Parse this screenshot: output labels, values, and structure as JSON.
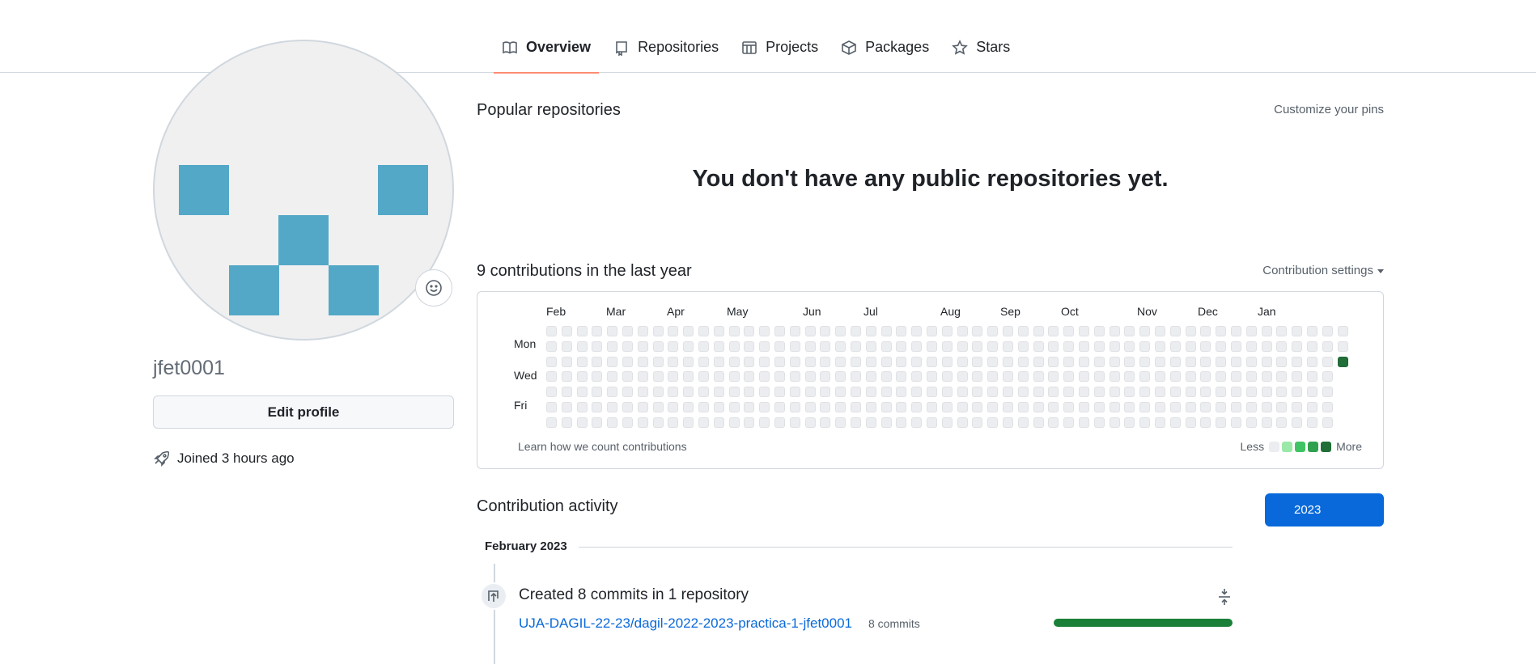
{
  "tabs": [
    {
      "label": "Overview",
      "icon": "book-icon",
      "active": true
    },
    {
      "label": "Repositories",
      "icon": "repo-icon",
      "active": false
    },
    {
      "label": "Projects",
      "icon": "table-icon",
      "active": false
    },
    {
      "label": "Packages",
      "icon": "package-icon",
      "active": false
    },
    {
      "label": "Stars",
      "icon": "star-icon",
      "active": false
    }
  ],
  "profile": {
    "username": "jfet0001",
    "edit_label": "Edit profile",
    "joined": "Joined 3 hours ago",
    "avatar_color": "#54a8c7",
    "status_icon": "smiley-icon"
  },
  "popular": {
    "title": "Popular repositories",
    "customize_label": "Customize your pins",
    "empty_message": "You don't have any public repositories yet."
  },
  "contributions": {
    "title": "9 contributions in the last year",
    "settings_label": "Contribution settings",
    "months": [
      "Feb",
      "Mar",
      "Apr",
      "May",
      "Jun",
      "Jul",
      "Aug",
      "Sep",
      "Oct",
      "Nov",
      "Dec",
      "Jan"
    ],
    "day_labels": [
      "Mon",
      "Wed",
      "Fri"
    ],
    "learn_label": "Learn how we count contributions",
    "legend_less": "Less",
    "legend_more": "More",
    "levels": [
      "#ebedf0",
      "#9be9a8",
      "#40c463",
      "#30a14e",
      "#216e39"
    ]
  },
  "activity": {
    "title": "Contribution activity",
    "year_label": "2023",
    "month_header": "February 2023",
    "summary": "Created 8 commits in 1 repository",
    "repo": "UJA-DAGIL-22-23/dagil-2022-2023-practica-1-jfet0001",
    "commits": "8 commits",
    "accent": "#1a7f37"
  }
}
